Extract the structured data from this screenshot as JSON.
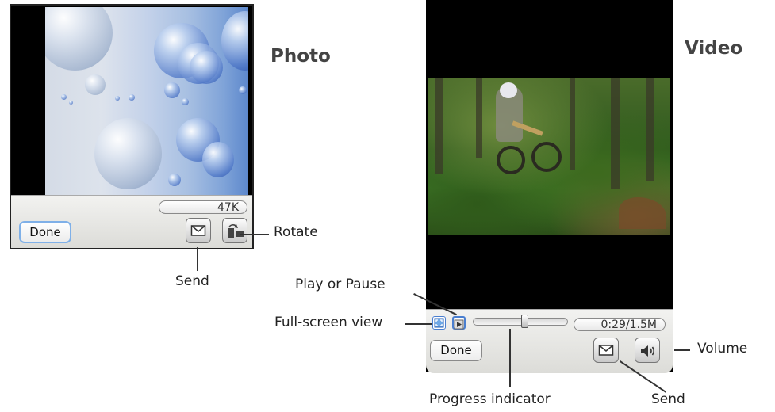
{
  "photo_section": {
    "heading": "Photo",
    "file_size": "47K",
    "done_label": "Done",
    "send_icon": "envelope-icon",
    "rotate_icon": "rotate-icon",
    "callouts": {
      "rotate": "Rotate",
      "send": "Send"
    }
  },
  "video_section": {
    "heading": "Video",
    "time_and_size": "0:29/1.5M",
    "done_label": "Done",
    "progress": 0.55,
    "send_icon": "envelope-icon",
    "volume_icon": "speaker-icon",
    "fullscreen_icon": "fullscreen-icon",
    "play_icon": "play-icon",
    "callouts": {
      "play_or_pause": "Play or Pause",
      "full_screen_view": "Full-screen view",
      "volume": "Volume",
      "progress_indicator": "Progress indicator",
      "send": "Send"
    }
  },
  "colors": {
    "focus_ring": "#7fb0e8",
    "panel_top": "#f2f2f0",
    "panel_bottom": "#dcdcd8"
  }
}
